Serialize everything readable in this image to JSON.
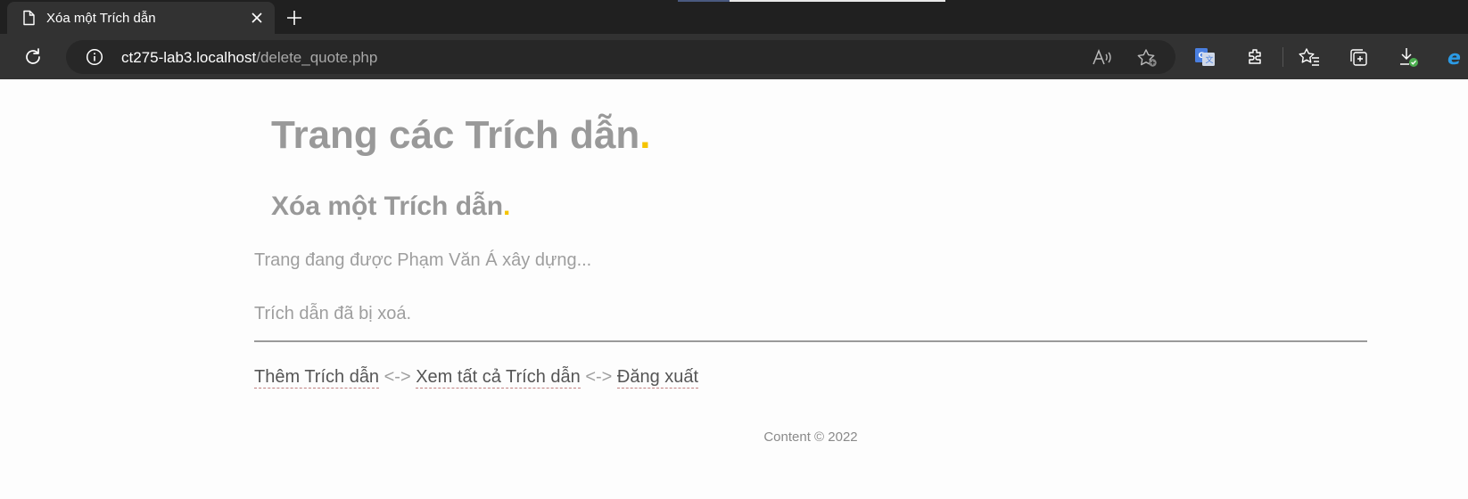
{
  "browser": {
    "tab": {
      "title": "Xóa một Trích dẫn"
    },
    "address": {
      "host": "ct275-lab3.localhost",
      "path": "/delete_quote.php"
    }
  },
  "page": {
    "title": "Trang các Trích dẫn",
    "subtitle": "Xóa một Trích dẫn",
    "title_dot": ".",
    "subtitle_dot": ".",
    "status_line": "Trang đang được Phạm Văn Á xây dựng...",
    "message": "Trích dẫn đã bị xoá.",
    "nav": {
      "add_quote": "Thêm Trích dẫn",
      "sep1": "<->",
      "view_all": "Xem tất cả Trích dẫn",
      "sep2": "<->",
      "logout": "Đăng xuất"
    },
    "footer": "Content © 2022"
  },
  "colors": {
    "accent_dot": "#f5c400",
    "heading": "#999999",
    "browser_chrome": "#323232"
  },
  "icons": [
    "document-icon",
    "close-icon",
    "new-tab-icon",
    "refresh-icon",
    "info-icon",
    "read-aloud-icon",
    "add-favorite-icon",
    "translate-icon",
    "extensions-icon",
    "favorites-icon",
    "collections-icon",
    "downloads-icon",
    "ie-mode-icon"
  ]
}
